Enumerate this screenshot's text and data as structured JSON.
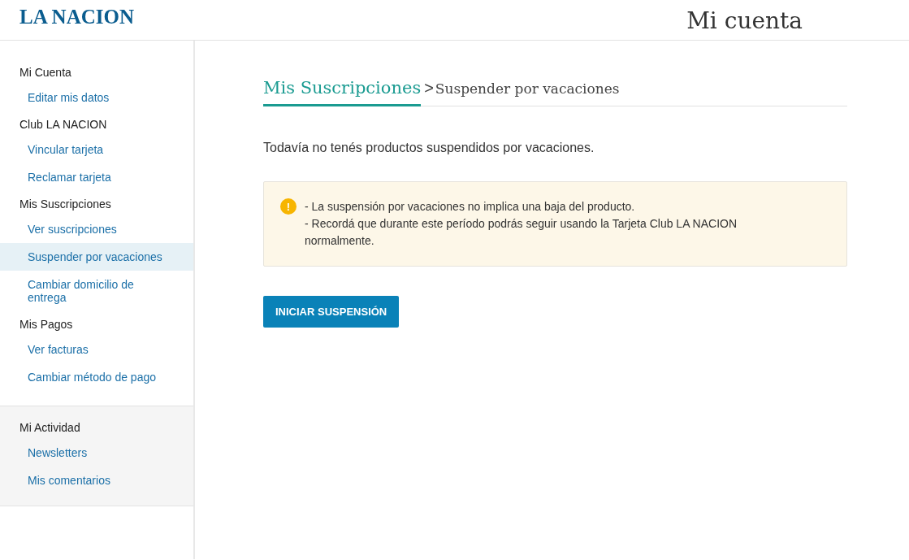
{
  "header": {
    "logo": "LA NACION",
    "title": "Mi cuenta"
  },
  "sidebar": {
    "sections": [
      {
        "heading": "Mi Cuenta",
        "shaded": false,
        "items": [
          {
            "label": "Editar mis datos",
            "selected": false
          }
        ]
      },
      {
        "heading": "Club LA NACION",
        "shaded": false,
        "items": [
          {
            "label": "Vincular tarjeta",
            "selected": false
          },
          {
            "label": "Reclamar tarjeta",
            "selected": false
          }
        ]
      },
      {
        "heading": "Mis Suscripciones",
        "shaded": false,
        "items": [
          {
            "label": "Ver suscripciones",
            "selected": false
          },
          {
            "label": "Suspender por vacaciones",
            "selected": true
          },
          {
            "label": "Cambiar domicilio de entrega",
            "selected": false
          }
        ]
      },
      {
        "heading": "Mis Pagos",
        "shaded": false,
        "items": [
          {
            "label": "Ver facturas",
            "selected": false
          },
          {
            "label": "Cambiar método de pago",
            "selected": false
          }
        ]
      },
      {
        "heading": "Mi Actividad",
        "shaded": true,
        "items": [
          {
            "label": "Newsletters",
            "selected": false
          },
          {
            "label": "Mis comentarios",
            "selected": false
          }
        ]
      }
    ]
  },
  "breadcrumb": {
    "parent": "Mis Suscripciones",
    "separator": ">",
    "current": "Suspender por vacaciones"
  },
  "message": "Todavía no tenés productos suspendidos por vacaciones.",
  "notice": {
    "icon": "!",
    "lines": [
      "- La suspensión por vacaciones no implica una baja del producto.",
      "- Recordá que durante este período podrás seguir usando la Tarjeta Club LA NACION normalmente."
    ]
  },
  "button": "INICIAR SUSPENSIÓN"
}
